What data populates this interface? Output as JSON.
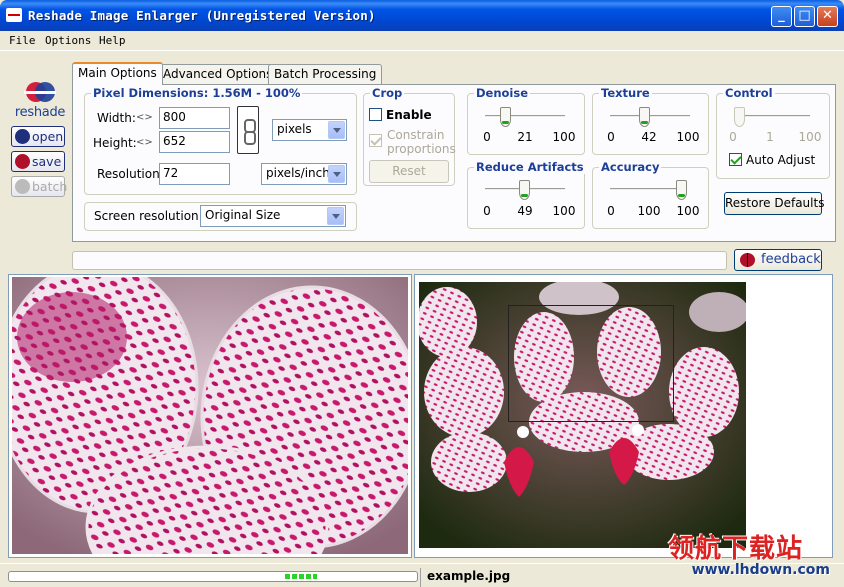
{
  "window": {
    "title": "Reshade Image Enlarger (Unregistered Version)",
    "min": "_",
    "max": "□",
    "close": "✕"
  },
  "menu": [
    "File",
    "Options",
    "Help"
  ],
  "toolbar": {
    "logo": "reshade",
    "open": "open",
    "save": "save",
    "batch": "batch"
  },
  "tabs": [
    "Main Options",
    "Advanced Options",
    "Batch Processing"
  ],
  "pixel_dimensions": {
    "title": "Pixel Dimensions:  1.56M - 100%",
    "width_label": "Width:",
    "width_value": "800",
    "height_label": "Height:",
    "height_value": "652",
    "unit": "pixels",
    "resolution_label": "Resolution",
    "resolution_value": "72",
    "resolution_unit": "pixels/inch"
  },
  "screen_resolution": {
    "label": "Screen resolution",
    "value": "Original Size"
  },
  "crop": {
    "title": "Crop",
    "enable": "Enable",
    "constrain": "Constrain proportions",
    "reset": "Reset"
  },
  "denoise": {
    "title": "Denoise",
    "min": "0",
    "value": "21",
    "max": "100",
    "level": 0.21
  },
  "texture": {
    "title": "Texture",
    "min": "0",
    "value": "42",
    "max": "100",
    "level": 0.42
  },
  "reduce_artifacts": {
    "title": "Reduce Artifacts",
    "min": "0",
    "value": "49",
    "max": "100",
    "level": 0.49
  },
  "accuracy": {
    "title": "Accuracy",
    "min": "0",
    "value": "100",
    "max": "100",
    "level": 1.0
  },
  "control": {
    "title": "Control",
    "min": "0",
    "value": "1",
    "max": "100",
    "level": 0.0,
    "auto_adjust": "Auto Adjust"
  },
  "restore_defaults": "Restore Defaults",
  "feedback": "feedback",
  "status": {
    "filename": "example.jpg"
  },
  "watermark": {
    "main": "领航下载站",
    "sub": "www.lhdown.com"
  },
  "colors": {
    "accent": "#1d3f98",
    "title_bar": "#0055e5",
    "orchid_pink": "#c8186c"
  }
}
